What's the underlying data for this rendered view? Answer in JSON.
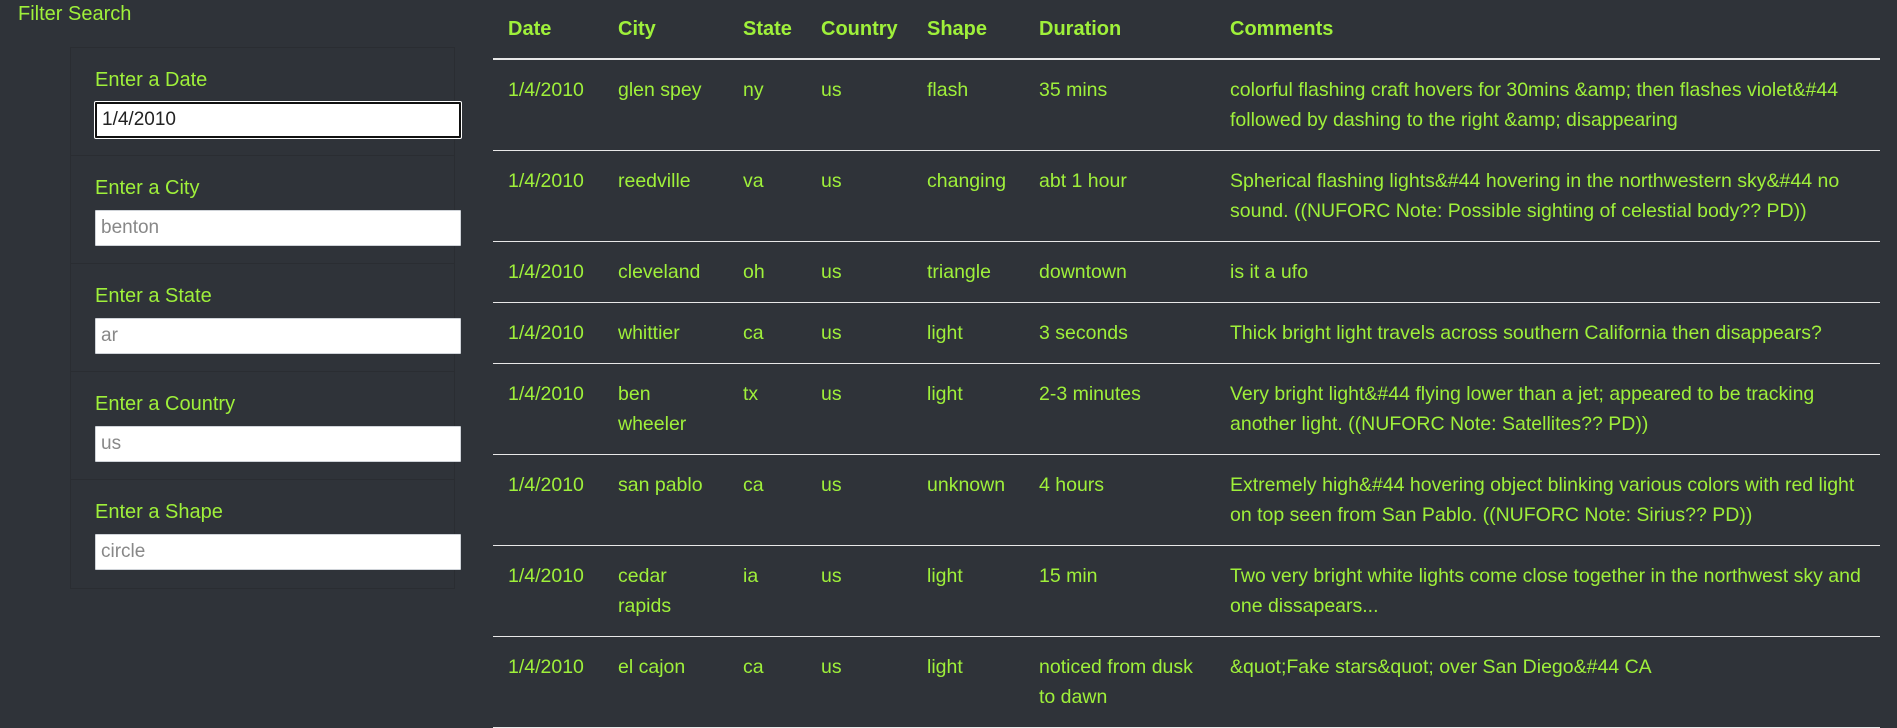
{
  "sidebar": {
    "title": "Filter Search",
    "filters": [
      {
        "label": "Enter a Date",
        "value": "1/4/2010",
        "placeholder": ""
      },
      {
        "label": "Enter a City",
        "value": "",
        "placeholder": "benton"
      },
      {
        "label": "Enter a State",
        "value": "",
        "placeholder": "ar"
      },
      {
        "label": "Enter a Country",
        "value": "",
        "placeholder": "us"
      },
      {
        "label": "Enter a Shape",
        "value": "",
        "placeholder": "circle"
      }
    ]
  },
  "table": {
    "headers": [
      "Date",
      "City",
      "State",
      "Country",
      "Shape",
      "Duration",
      "Comments"
    ],
    "rows": [
      [
        "1/4/2010",
        "glen spey",
        "ny",
        "us",
        "flash",
        "35 mins",
        "colorful flashing craft hovers for 30mins &amp; then flashes violet&#44 followed by dashing to the right &amp; disappearing"
      ],
      [
        "1/4/2010",
        "reedville",
        "va",
        "us",
        "changing",
        "abt 1 hour",
        "Spherical flashing lights&#44 hovering in the northwestern sky&#44 no sound. ((NUFORC Note: Possible sighting of celestial body?? PD))"
      ],
      [
        "1/4/2010",
        "cleveland",
        "oh",
        "us",
        "triangle",
        "downtown",
        "is it a ufo"
      ],
      [
        "1/4/2010",
        "whittier",
        "ca",
        "us",
        "light",
        "3 seconds",
        "Thick bright light travels across southern California then disappears?"
      ],
      [
        "1/4/2010",
        "ben wheeler",
        "tx",
        "us",
        "light",
        "2-3 minutes",
        "Very bright light&#44 flying lower than a jet; appeared to be tracking another light. ((NUFORC Note: Satellites?? PD))"
      ],
      [
        "1/4/2010",
        "san pablo",
        "ca",
        "us",
        "unknown",
        "4 hours",
        "Extremely high&#44 hovering object blinking various colors with red light on top seen from San Pablo. ((NUFORC Note: Sirius?? PD))"
      ],
      [
        "1/4/2010",
        "cedar rapids",
        "ia",
        "us",
        "light",
        "15 min",
        "Two very bright white lights come close together in the northwest sky and one dissapears..."
      ],
      [
        "1/4/2010",
        "el cajon",
        "ca",
        "us",
        "light",
        "noticed from dusk to dawn",
        "&quot;Fake stars&quot; over San Diego&#44 CA"
      ]
    ]
  },
  "colors": {
    "background": "#2f3339",
    "text_accent": "#9ff03a",
    "row_divider": "#e8e8e8"
  }
}
